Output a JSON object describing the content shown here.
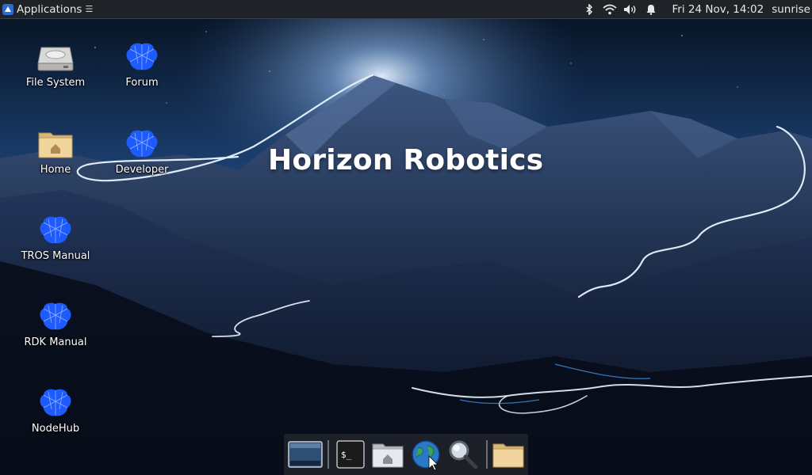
{
  "topbar": {
    "applications_label": "Applications",
    "clock": "Fri 24 Nov, 14:02",
    "user": "sunrise",
    "tray_icons": [
      "bluetooth-icon",
      "wifi-icon",
      "volume-icon",
      "bell-icon"
    ]
  },
  "desktop": {
    "brand_text": "Horizon Robotics",
    "icons": [
      {
        "label": "File System",
        "icon": "drive-icon"
      },
      {
        "label": "Forum",
        "icon": "brain-icon"
      },
      {
        "label": "Home",
        "icon": "home-folder-icon"
      },
      {
        "label": "Developer",
        "icon": "brain-icon"
      },
      {
        "label": "TROS Manual",
        "icon": "brain-icon"
      },
      {
        "label": "RDK Manual",
        "icon": "brain-icon"
      },
      {
        "label": "NodeHub",
        "icon": "brain-icon"
      }
    ]
  },
  "dock": {
    "items": [
      "show-desktop-icon",
      "terminal-icon",
      "home-folder-icon",
      "web-browser-icon",
      "search-icon",
      "file-manager-icon"
    ],
    "terminal_glyph": "$_"
  },
  "colors": {
    "brain_blue": "#1e5bff",
    "panel_bg": "#1f2328"
  }
}
